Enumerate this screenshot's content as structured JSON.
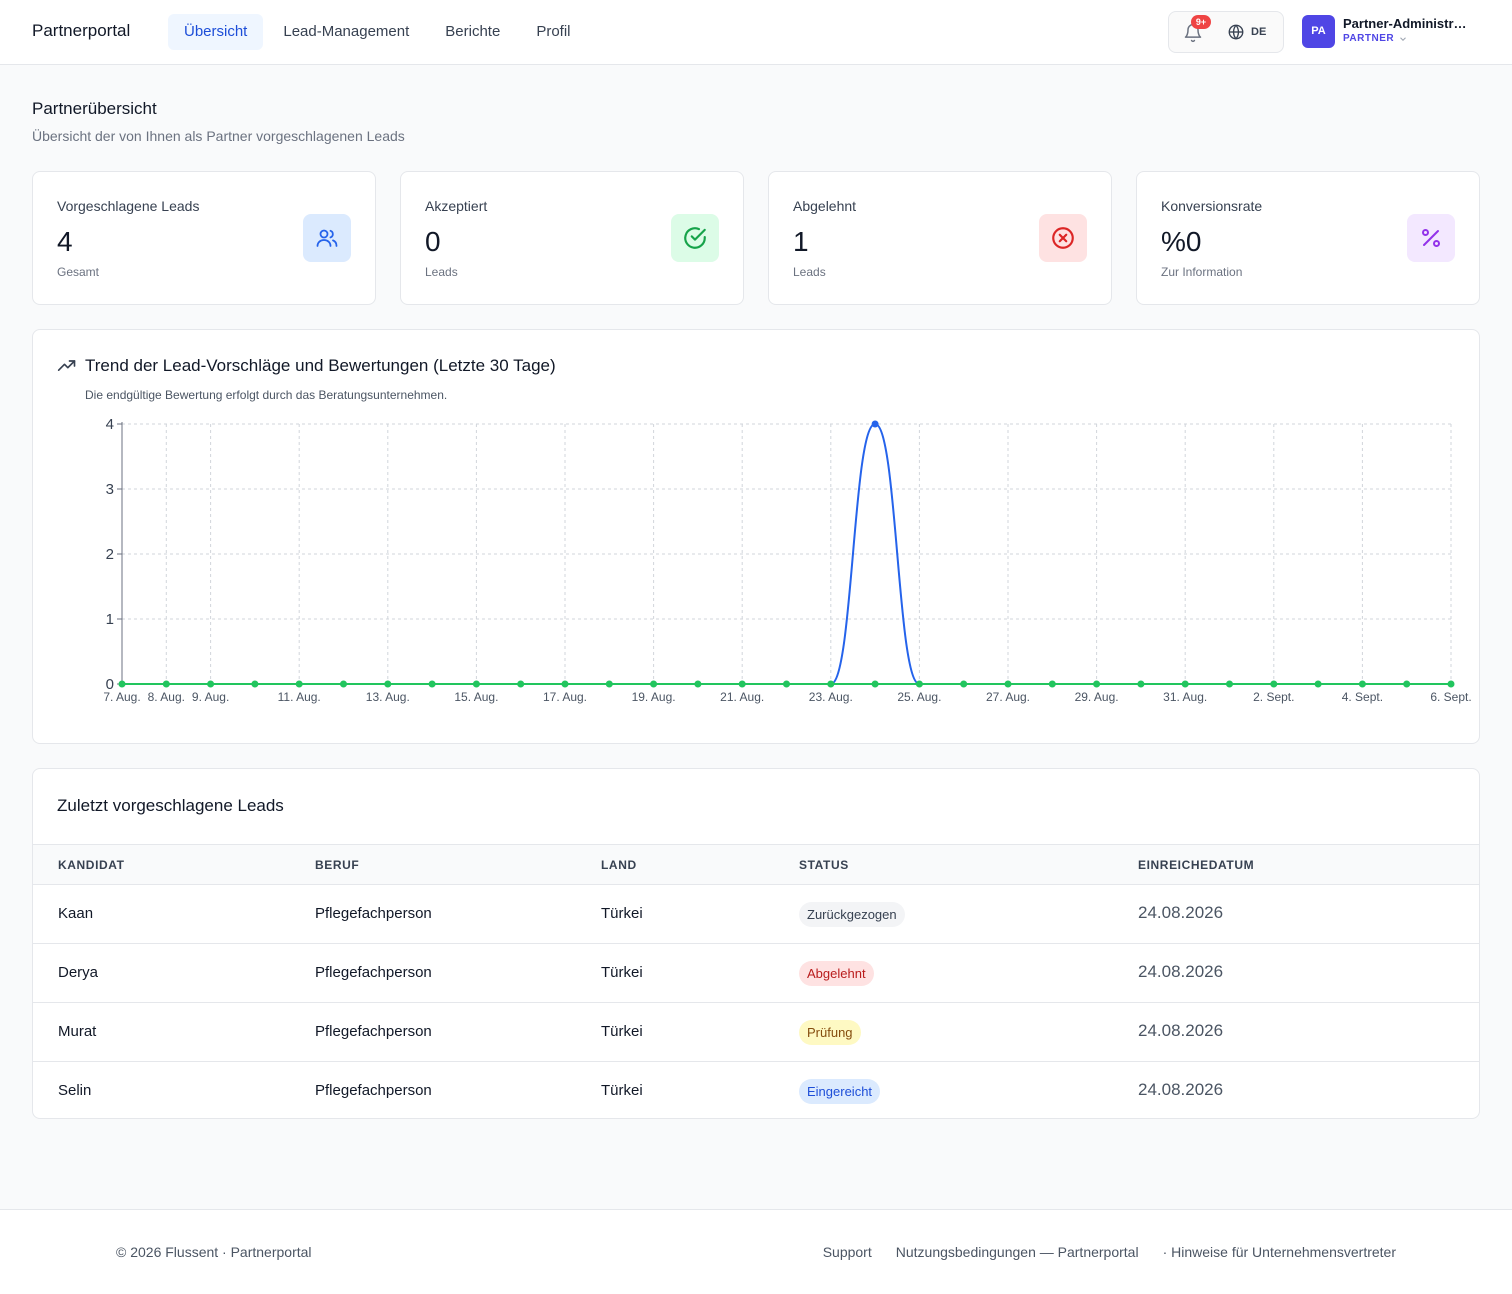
{
  "header": {
    "brand": "Partnerportal",
    "nav": [
      {
        "label": "Übersicht",
        "active": true
      },
      {
        "label": "Lead-Management",
        "active": false
      },
      {
        "label": "Berichte",
        "active": false
      },
      {
        "label": "Profil",
        "active": false
      }
    ],
    "notifications_badge": "9+",
    "language": "DE",
    "user": {
      "initials": "PA",
      "name": "Partner-Administrator",
      "role": "PARTNER"
    }
  },
  "page": {
    "title": "Partnerübersicht",
    "subtitle": "Übersicht der von Ihnen als Partner vorgeschlagenen Leads"
  },
  "stats": [
    {
      "label": "Vorgeschlagene Leads",
      "value": "4",
      "note": "Gesamt",
      "icon": "users-icon",
      "bg": "#dbeafe",
      "fg": "#2563eb"
    },
    {
      "label": "Akzeptiert",
      "value": "0",
      "note": "Leads",
      "icon": "check-circle-icon",
      "bg": "#dcfce7",
      "fg": "#16a34a"
    },
    {
      "label": "Abgelehnt",
      "value": "1",
      "note": "Leads",
      "icon": "x-circle-icon",
      "bg": "#fee2e2",
      "fg": "#dc2626"
    },
    {
      "label": "Konversionsrate",
      "value": "%0",
      "note": "Zur Information",
      "icon": "percent-icon",
      "bg": "#f3e8ff",
      "fg": "#9333ea"
    }
  ],
  "trend": {
    "title": "Trend der Lead-Vorschläge und Bewertungen (Letzte 30 Tage)",
    "subtitle": "Die endgültige Bewertung erfolgt durch das Beratungsunternehmen."
  },
  "chart_data": {
    "type": "line",
    "x": [
      "7. Aug.",
      "8. Aug.",
      "9. Aug.",
      "10. Aug.",
      "11. Aug.",
      "12. Aug.",
      "13. Aug.",
      "14. Aug.",
      "15. Aug.",
      "16. Aug.",
      "17. Aug.",
      "18. Aug.",
      "19. Aug.",
      "20. Aug.",
      "21. Aug.",
      "22. Aug.",
      "23. Aug.",
      "24. Aug.",
      "25. Aug.",
      "26. Aug.",
      "27. Aug.",
      "28. Aug.",
      "29. Aug.",
      "30. Aug.",
      "31. Aug.",
      "1. Sept.",
      "2. Sept.",
      "3. Sept.",
      "4. Sept.",
      "5. Sept.",
      "6. Sept."
    ],
    "x_tick_labels": [
      "7. Aug.",
      "8. Aug.",
      "9. Aug.",
      "11. Aug.",
      "13. Aug.",
      "15. Aug.",
      "17. Aug.",
      "19. Aug.",
      "21. Aug.",
      "23. Aug.",
      "25. Aug.",
      "27. Aug.",
      "29. Aug.",
      "31. Aug.",
      "2. Sept.",
      "4. Sept.",
      "6. Sept."
    ],
    "yticks": [
      0,
      1,
      2,
      3,
      4
    ],
    "ylim": [
      0,
      4
    ],
    "grid": true,
    "series": [
      {
        "color": "#2563eb",
        "values": [
          0,
          0,
          0,
          0,
          0,
          0,
          0,
          0,
          0,
          0,
          0,
          0,
          0,
          0,
          0,
          0,
          0,
          4,
          0,
          0,
          0,
          0,
          0,
          0,
          0,
          0,
          0,
          0,
          0,
          0,
          0
        ]
      },
      {
        "color": "#22c55e",
        "values": [
          0,
          0,
          0,
          0,
          0,
          0,
          0,
          0,
          0,
          0,
          0,
          0,
          0,
          0,
          0,
          0,
          0,
          0,
          0,
          0,
          0,
          0,
          0,
          0,
          0,
          0,
          0,
          0,
          0,
          0,
          0
        ]
      }
    ]
  },
  "recent": {
    "title": "Zuletzt vorgeschlagene Leads",
    "columns": [
      "KANDIDAT",
      "BERUF",
      "LAND",
      "STATUS",
      "EINREICHEDATUM"
    ],
    "rows": [
      {
        "name": "Kaan",
        "job": "Pflegefachperson",
        "country": "Türkei",
        "status": "Zurückgezogen",
        "tone": "gray",
        "date": "24.08.2026"
      },
      {
        "name": "Derya",
        "job": "Pflegefachperson",
        "country": "Türkei",
        "status": "Abgelehnt",
        "tone": "red",
        "date": "24.08.2026"
      },
      {
        "name": "Murat",
        "job": "Pflegefachperson",
        "country": "Türkei",
        "status": "Prüfung",
        "tone": "yellow",
        "date": "24.08.2026"
      },
      {
        "name": "Selin",
        "job": "Pflegefachperson",
        "country": "Türkei",
        "status": "Eingereicht",
        "tone": "blue",
        "date": "24.08.2026"
      }
    ]
  },
  "footer": {
    "copyright": "© 2026 Flussent · Partnerportal",
    "links": [
      "Support",
      "Nutzungsbedingungen — Partnerportal",
      "· Hinweise für Unternehmensvertreter"
    ]
  }
}
